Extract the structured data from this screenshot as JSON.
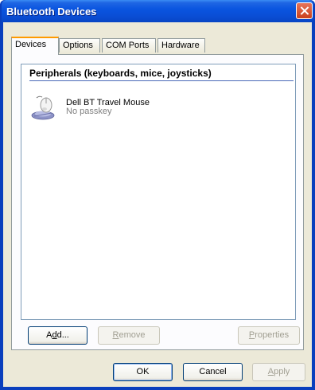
{
  "window": {
    "title": "Bluetooth Devices"
  },
  "tabs": [
    {
      "label": "Devices",
      "active": true
    },
    {
      "label": "Options",
      "active": false
    },
    {
      "label": "COM Ports",
      "active": false
    },
    {
      "label": "Hardware",
      "active": false
    }
  ],
  "devices_panel": {
    "group_header": "Peripherals (keyboards, mice, joysticks)",
    "items": [
      {
        "name": "Dell BT Travel Mouse",
        "status": "No passkey",
        "icon": "bluetooth-mouse-icon"
      }
    ],
    "buttons": {
      "add": {
        "pre": "A",
        "u": "d",
        "post": "d..."
      },
      "remove": {
        "pre": "",
        "u": "R",
        "post": "emove"
      },
      "properties": {
        "pre": "",
        "u": "P",
        "post": "roperties"
      }
    }
  },
  "dialog_buttons": {
    "ok": "OK",
    "cancel": "Cancel",
    "apply": {
      "pre": "",
      "u": "A",
      "post": "pply"
    }
  },
  "colors": {
    "title_bar": "#0a55e0",
    "close_button": "#c9411d",
    "active_tab_accent": "#ff9a00",
    "dialog_bg": "#ece9d8"
  }
}
